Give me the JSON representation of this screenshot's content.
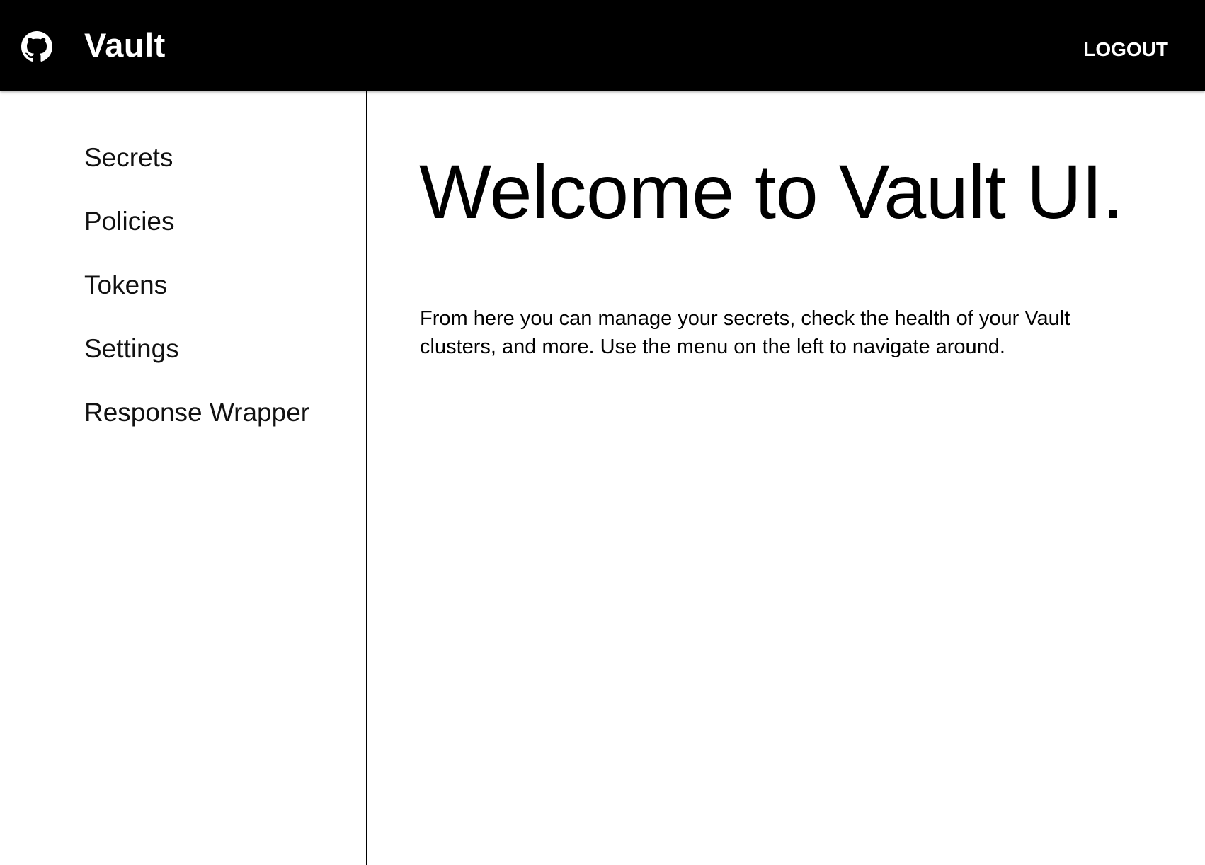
{
  "header": {
    "logo_icon": "github-icon",
    "title": "Vault",
    "logout_label": "LOGOUT",
    "background_color": "#000000",
    "text_color": "#ffffff"
  },
  "sidebar": {
    "items": [
      {
        "label": "Secrets"
      },
      {
        "label": "Policies"
      },
      {
        "label": "Tokens"
      },
      {
        "label": "Settings"
      },
      {
        "label": "Response Wrapper"
      }
    ]
  },
  "main": {
    "heading": "Welcome to Vault UI.",
    "intro": "From here you can manage your secrets, check the health of your Vault clusters, and more. Use the menu on the left to navigate around."
  }
}
